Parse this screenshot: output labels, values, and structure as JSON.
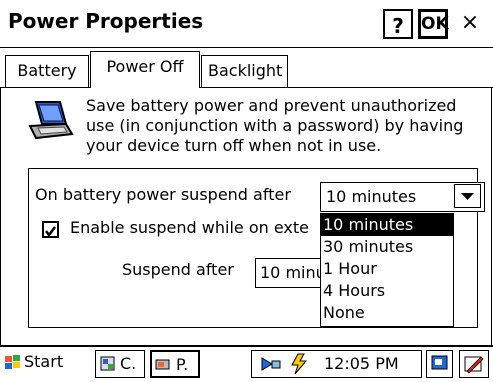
{
  "window": {
    "title": "Power Properties",
    "help_label": "?",
    "ok_label": "OK",
    "close_label": "×"
  },
  "tabs": [
    {
      "label": "Battery"
    },
    {
      "label": "Power Off"
    },
    {
      "label": "Backlight"
    }
  ],
  "description": "Save battery power and prevent unauthorized use (in conjunction with a password) by having your device turn off when not in use.",
  "settings": {
    "battery_label": "On battery power suspend after",
    "battery_value": "10 minutes",
    "external_checkbox_label": "Enable suspend while on exte",
    "external_checked": true,
    "suspend_after_label": "Suspend after",
    "suspend_after_value": "10 minu"
  },
  "dropdown": {
    "options": [
      "10 minutes",
      "30 minutes",
      "1 Hour",
      "4 Hours",
      "None"
    ],
    "selected": "10 minutes"
  },
  "taskbar": {
    "start_label": "Start",
    "task1_label": "C.",
    "task2_label": "P.",
    "clock": "12:05 PM"
  }
}
